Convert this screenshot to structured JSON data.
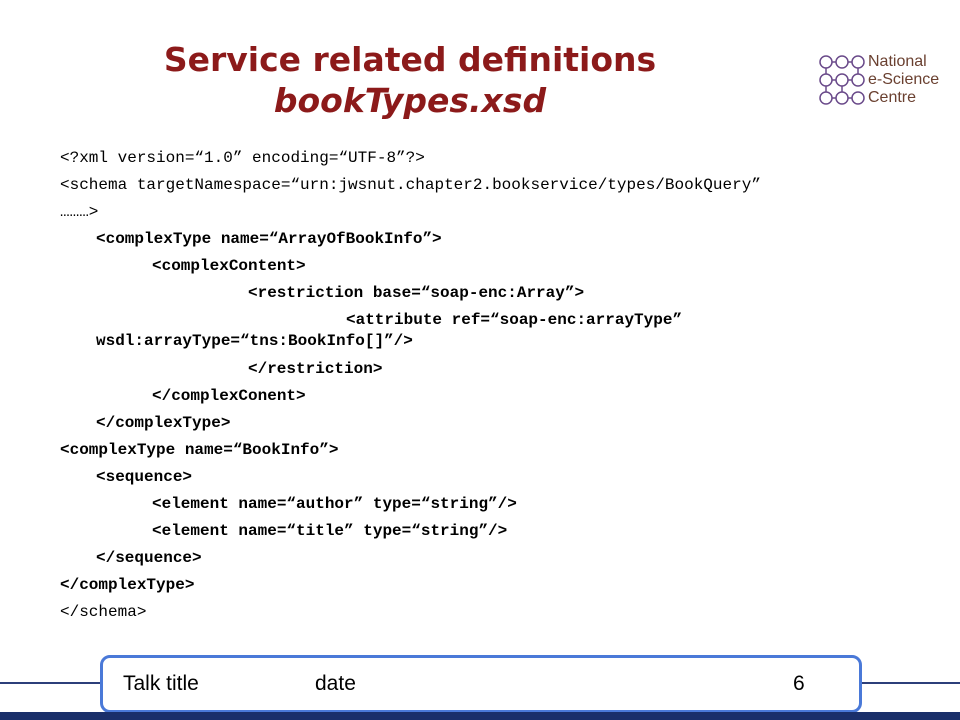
{
  "slide": {
    "title_line1": "Service related definitions",
    "title_line2": "bookTypes.xsd"
  },
  "logo": {
    "line1": "National",
    "line2": "e-Science",
    "line3": "Centre"
  },
  "code_lines": [
    "<?xml version=“1.0” encoding=“UTF-8”?>",
    "<schema targetNamespace=“urn:jwsnut.chapter2.bookservice/types/BookQuery”",
    "………>",
    "<complexType name=“ArrayOfBookInfo”>",
    "<complexContent>",
    "<restriction base=“soap-enc:Array”>",
    "<attribute ref=“soap-enc:arrayType”",
    "wsdl:arrayType=“tns:BookInfo[]”/>",
    "</restriction>",
    "</complexConent>",
    "</complexType>",
    "<complexType name=“BookInfo”>",
    "<sequence>",
    "<element name=“author” type=“string”/>",
    "<element name=“title” type=“string”/>",
    "</sequence>",
    "</complexType>",
    "</schema>"
  ],
  "footer": {
    "talk_title": "Talk title",
    "date": "date",
    "page_number": "6"
  },
  "colors": {
    "title": "#8c1a1a",
    "footer_border": "#4a79d8",
    "bottom_bar": "#1a2f6a"
  }
}
